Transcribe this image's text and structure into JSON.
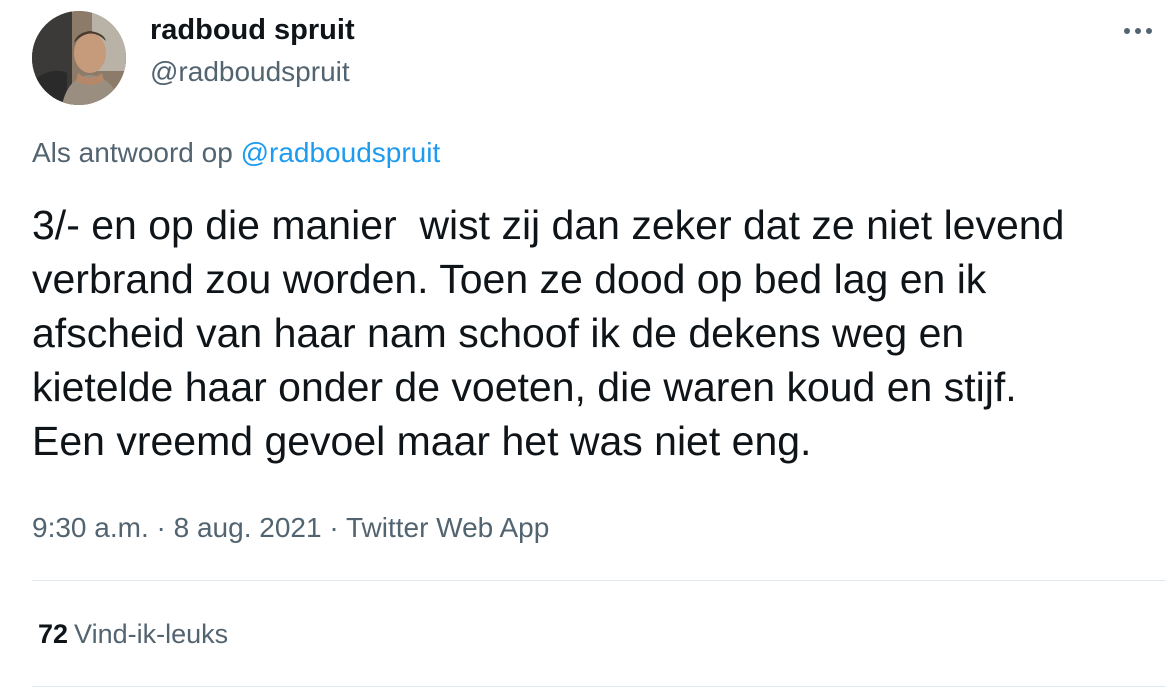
{
  "author": {
    "display_name": "radboud spruit",
    "handle": "@radboudspruit"
  },
  "reply_context": {
    "prefix": "Als antwoord op",
    "mention": "@radboudspruit"
  },
  "tweet": {
    "text": "3/- en op die manier  wist zij dan zeker dat ze niet levend\nverbrand zou worden. Toen ze dood op bed lag en ik\nafscheid van haar nam schoof ik de dekens weg en\nkietelde haar onder de voeten, die waren koud en stijf.\nEen vreemd gevoel maar het was niet eng."
  },
  "meta": {
    "time": "9:30 a.m.",
    "separator": "·",
    "date": "8 aug. 2021",
    "source": "Twitter Web App"
  },
  "stats": {
    "likes_count": "72",
    "likes_label": "Vind-ik-leuks"
  },
  "icons": {
    "more": "more-horizontal-icon"
  },
  "colors": {
    "link": "#1d9bf0",
    "secondary_text": "#536471",
    "primary_text": "#0f1419"
  }
}
